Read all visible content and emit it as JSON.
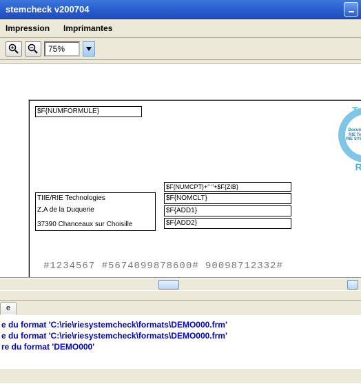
{
  "window": {
    "title": "stemcheck v200704"
  },
  "menu": {
    "impression": "Impression",
    "imprimantes": "Imprimantes"
  },
  "toolbar": {
    "zoom_value": "75%"
  },
  "check": {
    "num_formule": "$F{NUMFORMULE}",
    "sender_line1": "TIIE/RIE Technologies",
    "sender_line2": "Z.A de la Duquerie",
    "sender_line3": "37390 Chanceaux sur Choisille",
    "num_cpt_zib": "$F{NUMCPT}+\" \"+$F{ZIB}",
    "nom_clt": "$F{NOMCLT}",
    "add1": "$F{ADD1}",
    "add2": "$F{ADD2}",
    "stamp_top": "T.I.I.E",
    "stamp_bottom": "R.I.E",
    "stamp_center": "Documents Demo\nRIE Technologies\nRIE SYSTEMCHECK",
    "micr": "#1234567  #5674099878600#  90098712332#"
  },
  "tabs": {
    "tab1": "e"
  },
  "log": {
    "line1": "e du format 'C:\\rie\\riesystemcheck\\formats\\DEMO000.frm'",
    "line2": "e du format 'C:\\rie\\riesystemcheck\\formats\\DEMO000.frm'",
    "line3": "re du format 'DEMO000'"
  }
}
